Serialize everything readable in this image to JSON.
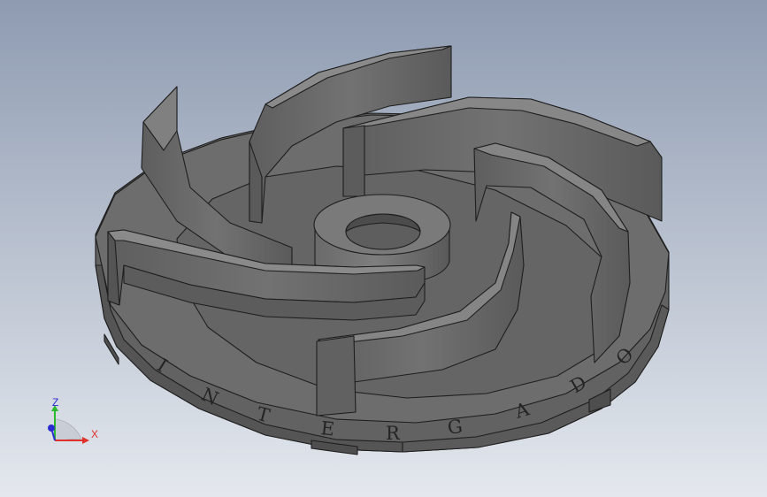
{
  "viewport": {
    "background_top": "#8e9bb1",
    "background_bottom": "#e4e8ee",
    "model_color": "#6b6b6b",
    "edge_color": "#1e1e1e"
  },
  "model": {
    "engraved_letters": [
      "I",
      "N",
      "T",
      "E",
      "R",
      "G",
      "A",
      "D",
      "O"
    ]
  },
  "triad": {
    "z_label": "Z",
    "x_label": "X",
    "z_color": "#2db92d",
    "x_color": "#e0302a",
    "y_color": "#2b2bd0"
  }
}
